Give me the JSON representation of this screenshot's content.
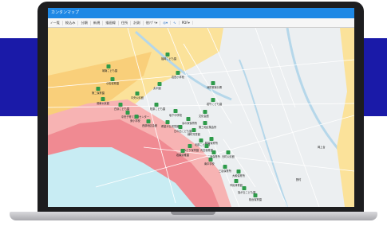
{
  "app": {
    "title": "カンタンマップ"
  },
  "toolbar": {
    "items": [
      "一覧",
      "絞込み",
      "分類",
      "新規",
      "描画線",
      "住所",
      "計測",
      "他ｱﾌﾟﾘ",
      "◎",
      "∿",
      "PDF"
    ],
    "dropdown_suffix": "▾"
  },
  "map": {
    "facilities": [
      "福岡こども園",
      "岩田小学校",
      "太平園",
      "消防署東分署",
      "若竹こども園",
      "城南こども園",
      "小松保育園",
      "第二保育園",
      "港南公民館",
      "白浜こども園",
      "中央子育て支援センター",
      "東小学校",
      "西部地区会館",
      "坂下中学校",
      "浜の家保育所",
      "日の出こども園",
      "文化会館",
      "第三地区集会所",
      "緑町児童館",
      "北部こども園",
      "駅前保育所",
      "みどり保育園",
      "若葉幼稚園",
      "青空保育園",
      "南中学校",
      "光町公民館",
      "大和保育所",
      "市民体育館",
      "旭が丘こども園",
      "桜台保育園",
      "三谷保育所",
      "二宮保育所",
      "希望が丘児童館",
      "松原こども園",
      "中央公民館"
    ],
    "places": [
      "岡上台",
      "野村"
    ],
    "colors": {
      "tsunami_light": "#fce9b0",
      "tsunami_mid": "#f8a7a7",
      "tsunami_deep": "#f07a85",
      "sea": "#c8ecf3",
      "marker": "#2e9b4a",
      "accent": "#1e88e5"
    }
  }
}
